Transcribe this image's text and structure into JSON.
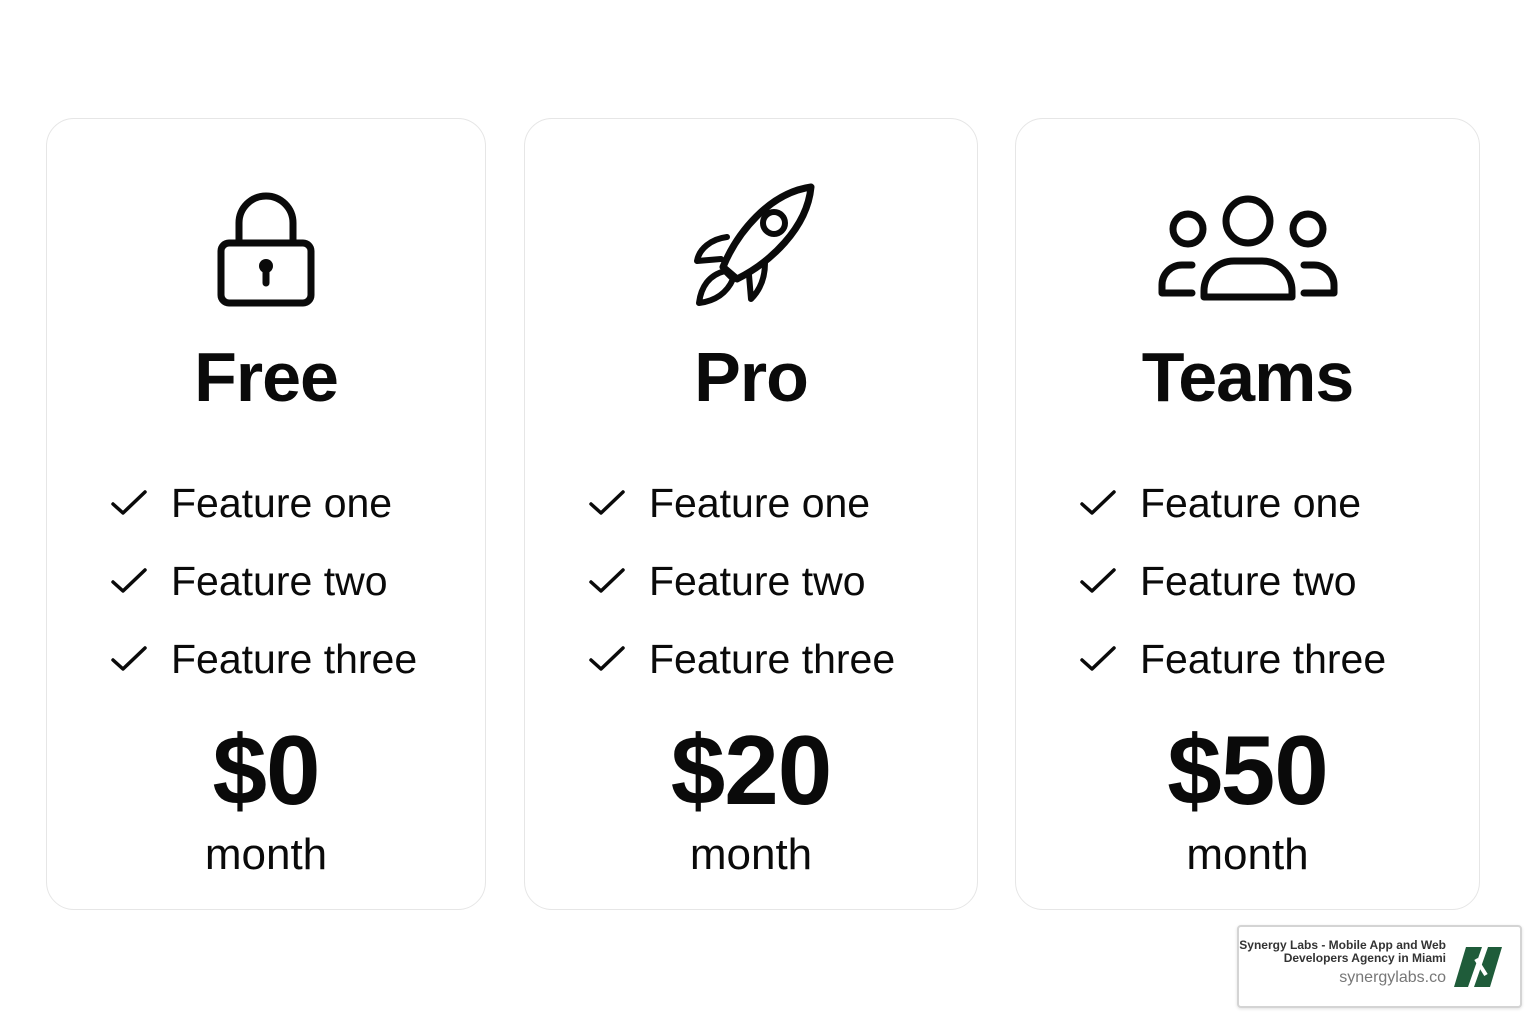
{
  "plans": [
    {
      "icon": "lock-icon",
      "name": "Free",
      "features": [
        "Feature one",
        "Feature two",
        "Feature three"
      ],
      "price": "$0",
      "period": "month"
    },
    {
      "icon": "rocket-icon",
      "name": "Pro",
      "features": [
        "Feature one",
        "Feature two",
        "Feature three"
      ],
      "price": "$20",
      "period": "month"
    },
    {
      "icon": "users-icon",
      "name": "Teams",
      "features": [
        "Feature one",
        "Feature two",
        "Feature three"
      ],
      "price": "$50",
      "period": "month"
    }
  ],
  "feature_marker_icon": "check-icon",
  "watermark": {
    "title": "Synergy Labs - Mobile App and Web Developers Agency in Miami",
    "url": "synergylabs.co",
    "logo_icon": "synergy-logo-icon",
    "logo_color": "#1f5c3a"
  },
  "colors": {
    "background": "#ffffff",
    "text": "#0a0a0a",
    "card_border": "#e6e6e6"
  }
}
